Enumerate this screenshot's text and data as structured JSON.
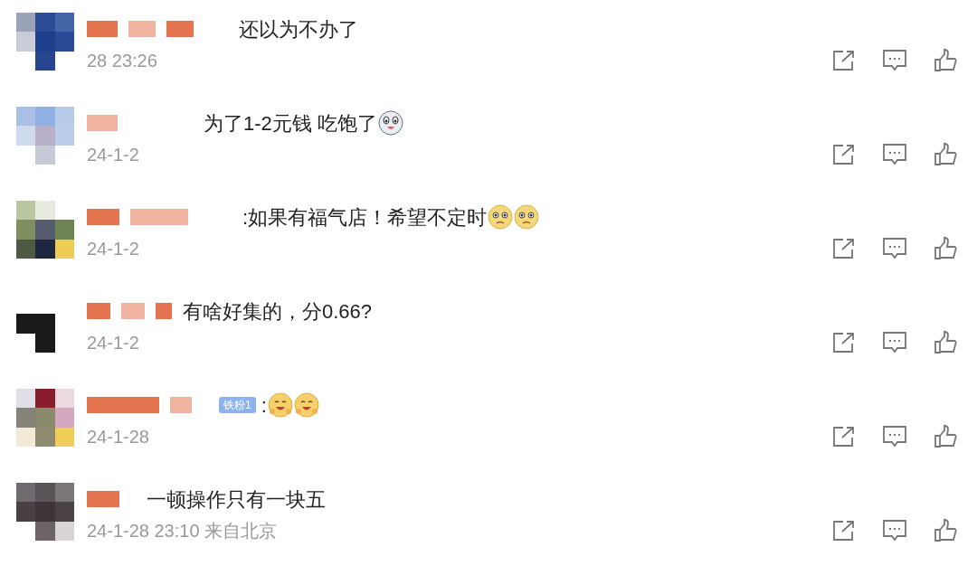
{
  "comments": [
    {
      "text": "还以为不办了",
      "time": "28 23:26"
    },
    {
      "text": "为了1-2元钱 吃饱了",
      "emojis": [
        {
          "kind": "dog"
        }
      ],
      "time": "24-1-2"
    },
    {
      "text": ":如果有福气店！希望不定时",
      "emojis": [
        {
          "kind": "sad"
        },
        {
          "kind": "sad"
        }
      ],
      "time": "24-1-2"
    },
    {
      "text": "有啥好集的，分0.66?",
      "time": "24-1-2"
    },
    {
      "badge": "铁粉1",
      "text": ":",
      "emojis": [
        {
          "kind": "grin"
        },
        {
          "kind": "grin"
        }
      ],
      "time": "24-1-28"
    },
    {
      "text": "一顿操作只有一块五",
      "time": "24-1-28 23:10 来自北京"
    }
  ]
}
